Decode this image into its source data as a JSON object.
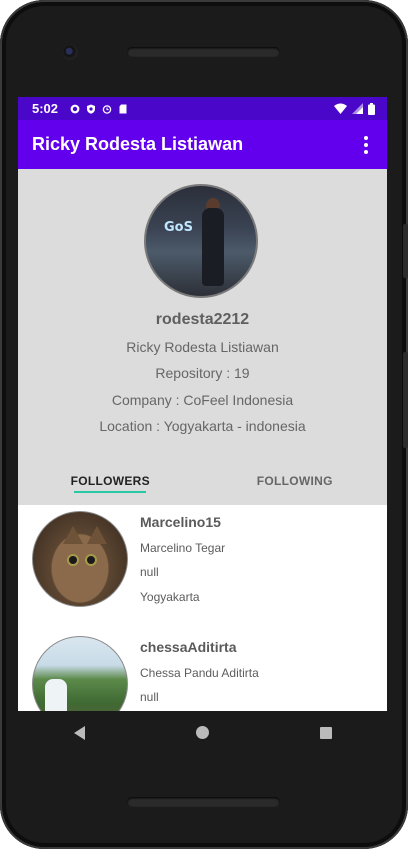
{
  "status_bar": {
    "time": "5:02",
    "icons": [
      "gear-icon",
      "shield-icon",
      "alarm-icon",
      "sd-card-icon",
      "wifi-icon",
      "signal-icon",
      "battery-icon"
    ]
  },
  "app_bar": {
    "title": "Ricky Rodesta Listiawan",
    "menu_icon": "more-vert-icon"
  },
  "profile": {
    "username": "rodesta2212",
    "full_name": "Ricky Rodesta Listiawan",
    "repository": "Repository : 19",
    "company": "Company : CoFeel Indonesia",
    "location": "Location : Yogyakarta - indonesia",
    "avatar_sign_text": "GoS"
  },
  "tabs": [
    {
      "label": "FOLLOWERS",
      "active": true
    },
    {
      "label": "FOLLOWING",
      "active": false
    }
  ],
  "followers": [
    {
      "login": "Marcelino15",
      "name": "Marcelino Tegar",
      "company": "null",
      "location": "Yogyakarta"
    },
    {
      "login": "chessaAditirta",
      "name": "Chessa Pandu Aditirta",
      "company": "null"
    }
  ],
  "colors": {
    "status_bar": "#4a07c9",
    "app_bar": "#6200ee",
    "tab_indicator": "#27c9a4",
    "profile_bg": "#dcdcdc"
  }
}
